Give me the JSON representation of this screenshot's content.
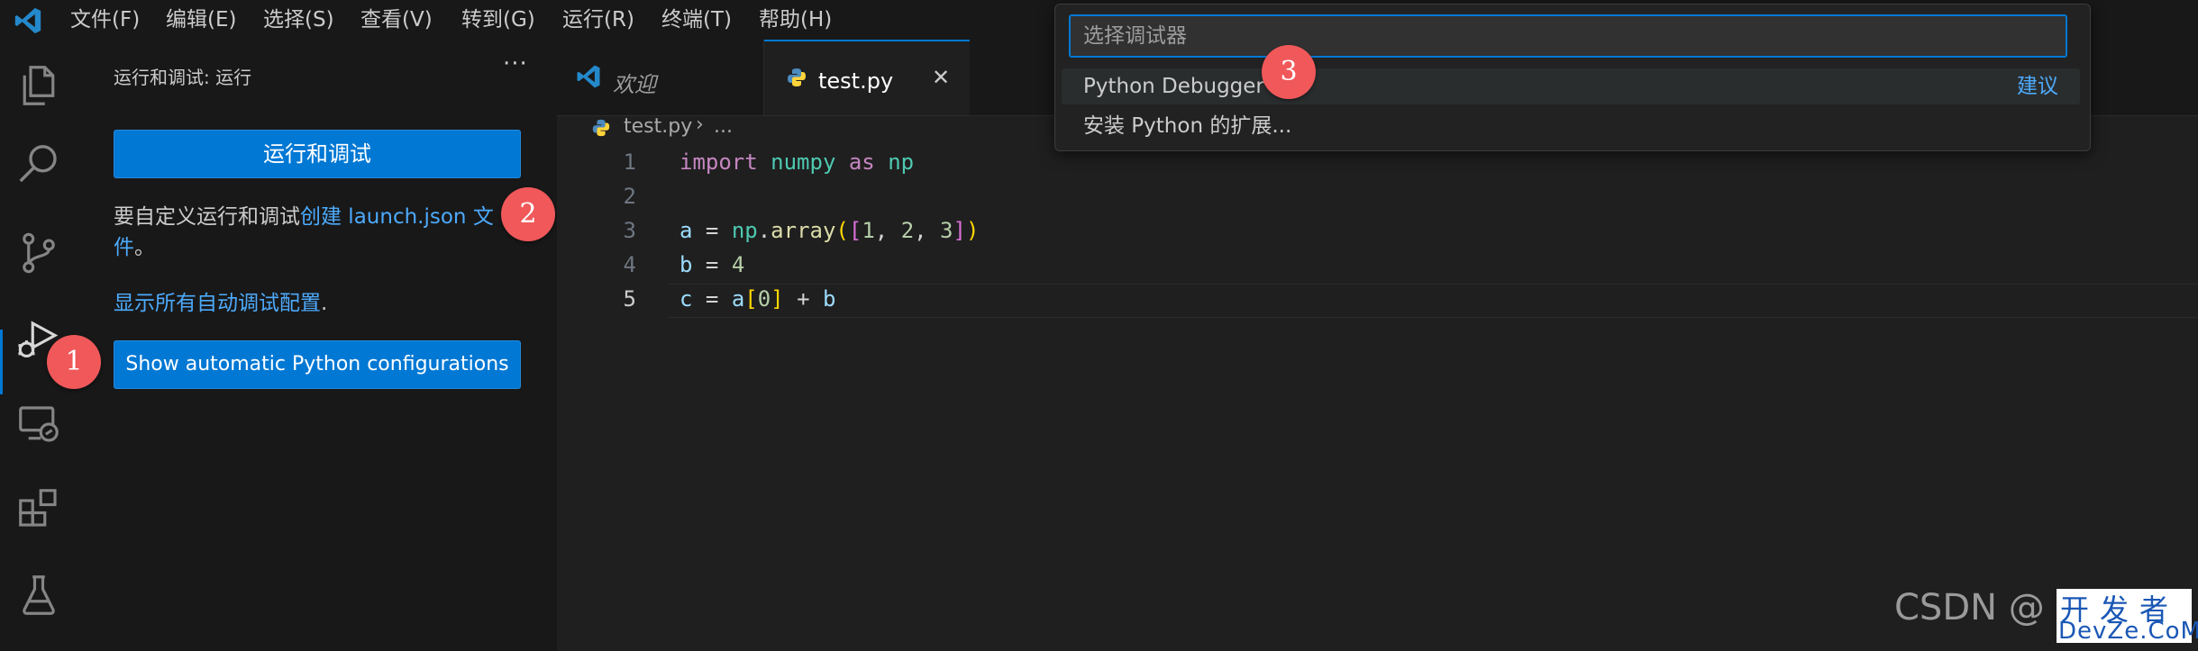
{
  "menubar": {
    "items": [
      "文件(F)",
      "编辑(E)",
      "选择(S)",
      "查看(V)",
      "转到(G)",
      "运行(R)",
      "终端(T)",
      "帮助(H)"
    ]
  },
  "activitybar": {
    "icons": [
      "files-icon",
      "search-icon",
      "source-control-icon",
      "run-debug-icon",
      "remote-explorer-icon",
      "extensions-icon",
      "testing-icon"
    ],
    "active": "run-debug-icon"
  },
  "sidebar": {
    "title": "运行和调试: 运行",
    "more": "···",
    "run_button": "运行和调试",
    "custom_text": "要自定义运行和调试",
    "create_link": "创建 launch.json 文",
    "create_link_cont": "件",
    "period": "。",
    "show_all_link": "显示所有自动调试配置",
    "show_all_period": ".",
    "python_button": "Show automatic Python configurations"
  },
  "tabs": [
    {
      "label": "欢迎",
      "active": false
    },
    {
      "label": "test.py",
      "active": true,
      "close": "✕"
    }
  ],
  "breadcrumb": {
    "file": "test.py",
    "sep": "›",
    "rest": "..."
  },
  "code": {
    "line_numbers": [
      "1",
      "2",
      "3",
      "4",
      "5"
    ],
    "current_line": "5",
    "lines": [
      [
        {
          "t": "import",
          "c": "kw"
        },
        {
          "t": " ",
          "c": "op"
        },
        {
          "t": "numpy",
          "c": "mod"
        },
        {
          "t": " ",
          "c": "op"
        },
        {
          "t": "as",
          "c": "kw"
        },
        {
          "t": " ",
          "c": "op"
        },
        {
          "t": "np",
          "c": "mod"
        }
      ],
      [],
      [
        {
          "t": "a",
          "c": "var"
        },
        {
          "t": " = ",
          "c": "op"
        },
        {
          "t": "np",
          "c": "mod"
        },
        {
          "t": ".",
          "c": "op"
        },
        {
          "t": "array",
          "c": "fn"
        },
        {
          "t": "(",
          "c": "br1"
        },
        {
          "t": "[",
          "c": "br2"
        },
        {
          "t": "1",
          "c": "num"
        },
        {
          "t": ", ",
          "c": "op"
        },
        {
          "t": "2",
          "c": "num"
        },
        {
          "t": ", ",
          "c": "op"
        },
        {
          "t": "3",
          "c": "num"
        },
        {
          "t": "]",
          "c": "br2"
        },
        {
          "t": ")",
          "c": "br1"
        }
      ],
      [
        {
          "t": "b",
          "c": "var"
        },
        {
          "t": " = ",
          "c": "op"
        },
        {
          "t": "4",
          "c": "num"
        }
      ],
      [
        {
          "t": "c",
          "c": "var"
        },
        {
          "t": " = ",
          "c": "op"
        },
        {
          "t": "a",
          "c": "var"
        },
        {
          "t": "[",
          "c": "br1"
        },
        {
          "t": "0",
          "c": "num"
        },
        {
          "t": "]",
          "c": "br1"
        },
        {
          "t": " + ",
          "c": "op"
        },
        {
          "t": "b",
          "c": "var"
        }
      ]
    ]
  },
  "quickpick": {
    "placeholder": "选择调试器",
    "items": [
      {
        "label": "Python Debugger",
        "badge": "建议",
        "selected": true
      },
      {
        "label": "安装 Python 的扩展...",
        "badge": "",
        "selected": false
      }
    ]
  },
  "callouts": [
    "1",
    "2",
    "3"
  ],
  "watermark": {
    "csdn": "CSDN @",
    "cn": "开发者",
    "en": "DevZe.CoM"
  },
  "colors": {
    "accent": "#0078d4",
    "link": "#4daafc",
    "callout": "#f0585a"
  }
}
